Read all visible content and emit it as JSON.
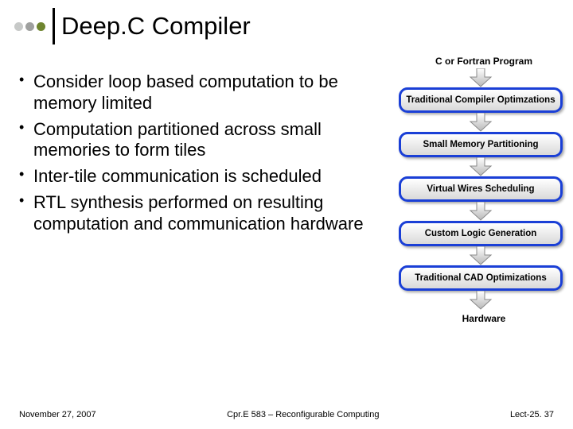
{
  "header": {
    "title": "Deep.C Compiler"
  },
  "bullets": [
    "Consider loop based computation to be memory limited",
    "Computation partitioned across small memories to form tiles",
    "Inter-tile communication is scheduled",
    "RTL synthesis performed on resulting computation and communication hardware"
  ],
  "flow": {
    "top_label": "C or Fortran Program",
    "stages": [
      "Traditional Compiler Optimzations",
      "Small Memory Partitioning",
      "Virtual Wires Scheduling",
      "Custom Logic Generation",
      "Traditional CAD Optimizations"
    ],
    "bottom_label": "Hardware"
  },
  "footer": {
    "left": "November 27, 2007",
    "center": "Cpr.E 583 – Reconfigurable Computing",
    "right": "Lect-25. 37"
  },
  "colors": {
    "stage_border": "#1a3fd6",
    "dot_accent": "#6f852f"
  }
}
